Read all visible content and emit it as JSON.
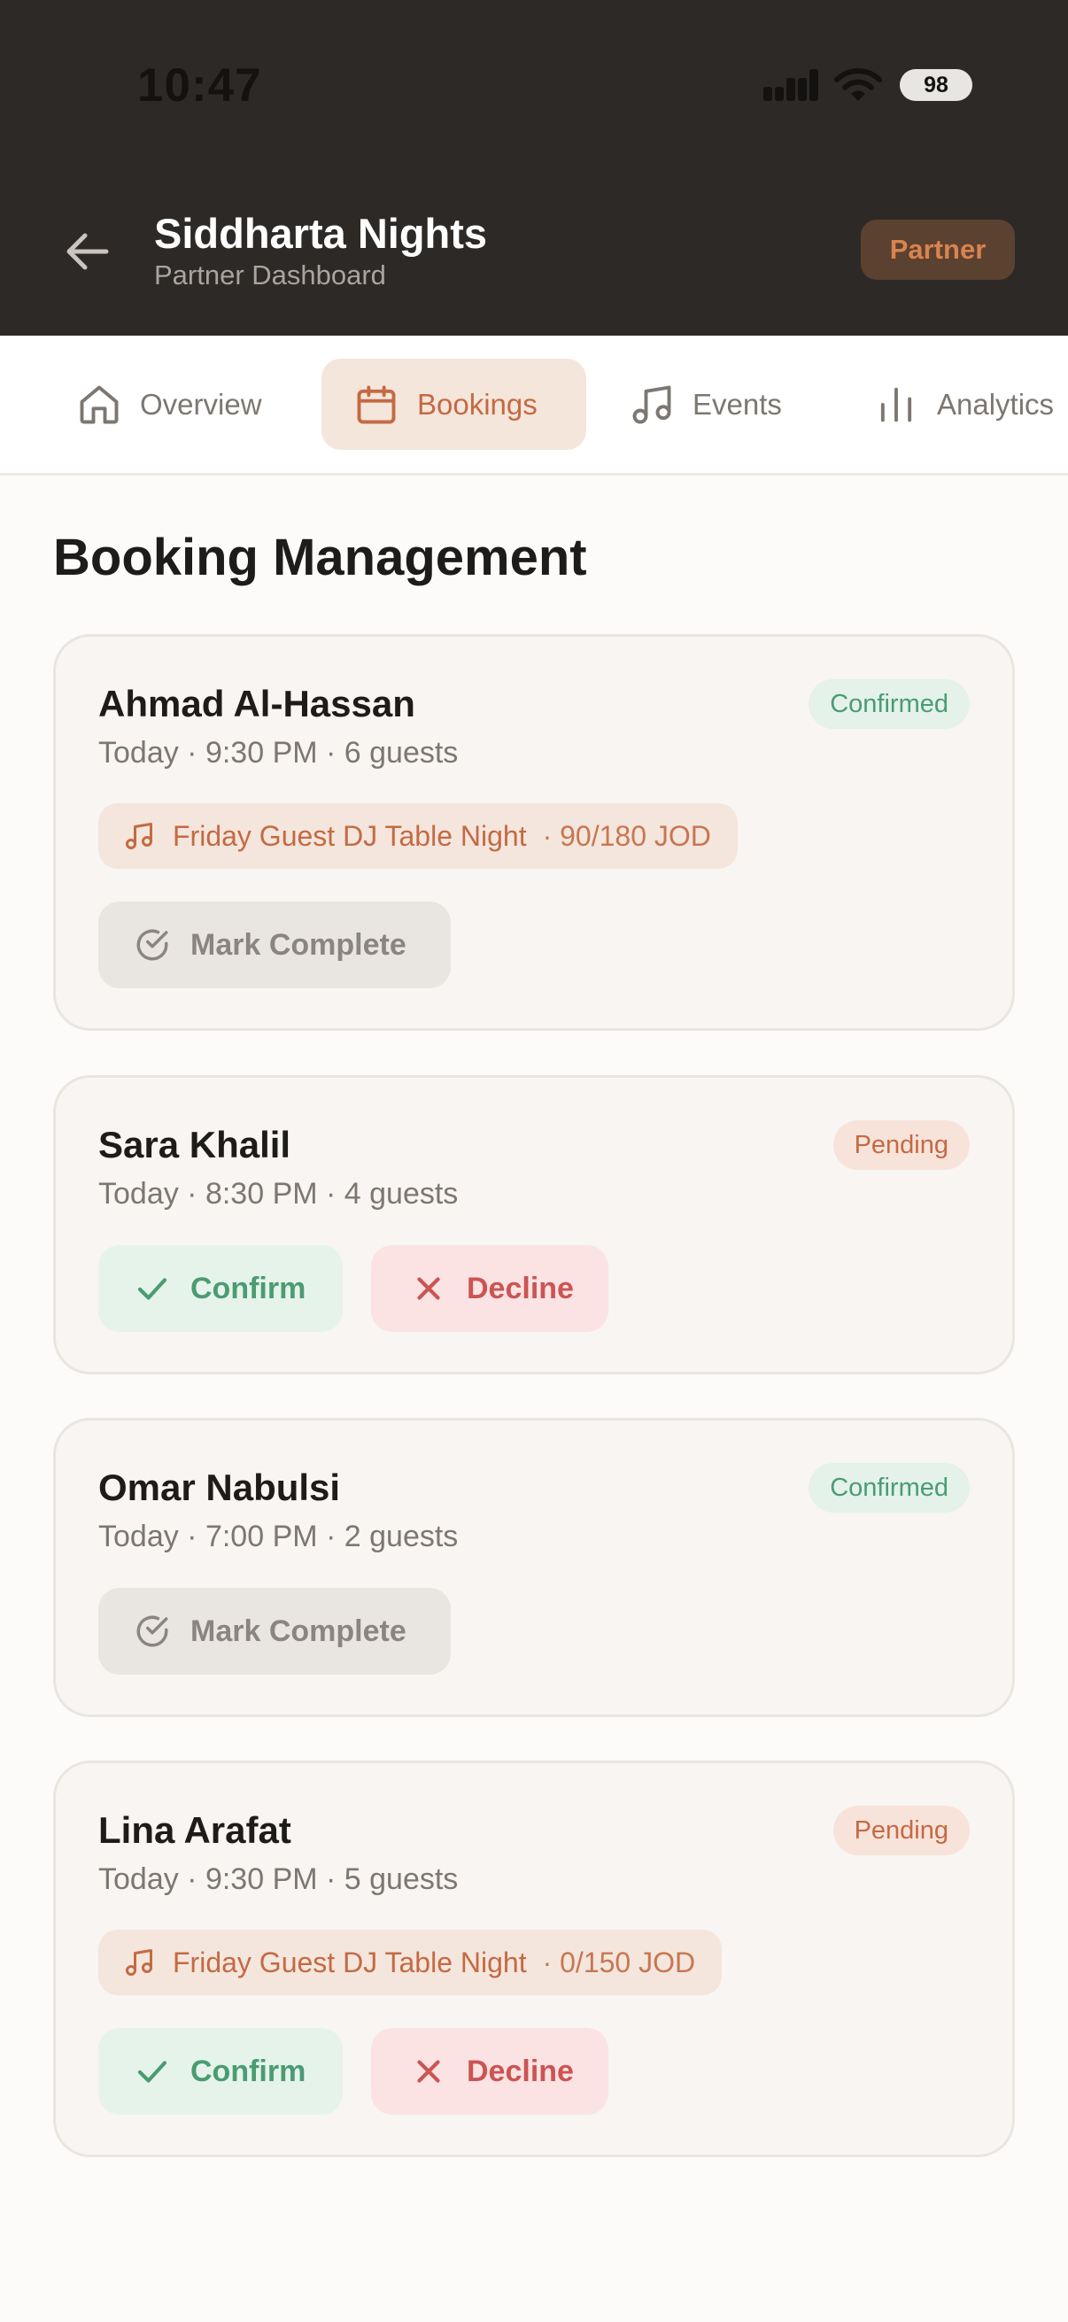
{
  "status_bar": {
    "time": "10:47",
    "battery": "98"
  },
  "header": {
    "title": "Siddharta Nights",
    "subtitle": "Partner Dashboard",
    "badge": "Partner"
  },
  "tabs": [
    {
      "label": "Overview",
      "icon": "home-icon",
      "active": false
    },
    {
      "label": "Bookings",
      "icon": "calendar-icon",
      "active": true
    },
    {
      "label": "Events",
      "icon": "music-note-icon",
      "active": false
    },
    {
      "label": "Analytics",
      "icon": "bar-chart-icon",
      "active": false
    }
  ],
  "section": {
    "title": "Booking Management"
  },
  "bookings": [
    {
      "name": "Ahmad Al-Hassan",
      "meta": "Today · 9:30 PM · 6 guests",
      "status": "Confirmed",
      "event": {
        "name": "Friday Guest DJ Table Night",
        "price": "· 90/180 JOD"
      },
      "actions": [
        "Mark Complete"
      ]
    },
    {
      "name": "Sara Khalil",
      "meta": "Today · 8:30 PM · 4 guests",
      "status": "Pending",
      "actions": [
        "Confirm",
        "Decline"
      ]
    },
    {
      "name": "Omar Nabulsi",
      "meta": "Today · 7:00 PM · 2 guests",
      "status": "Confirmed",
      "actions": [
        "Mark Complete"
      ]
    },
    {
      "name": "Lina Arafat",
      "meta": "Today · 9:30 PM · 5 guests",
      "status": "Pending",
      "event": {
        "name": "Friday Guest DJ Table Night",
        "price": "· 0/150 JOD"
      },
      "actions": [
        "Confirm",
        "Decline"
      ]
    }
  ],
  "colors": {
    "header_bg": "#2D2926",
    "accent": "#C46A43",
    "confirmed": "#4A9C72",
    "decline": "#CC5454"
  }
}
